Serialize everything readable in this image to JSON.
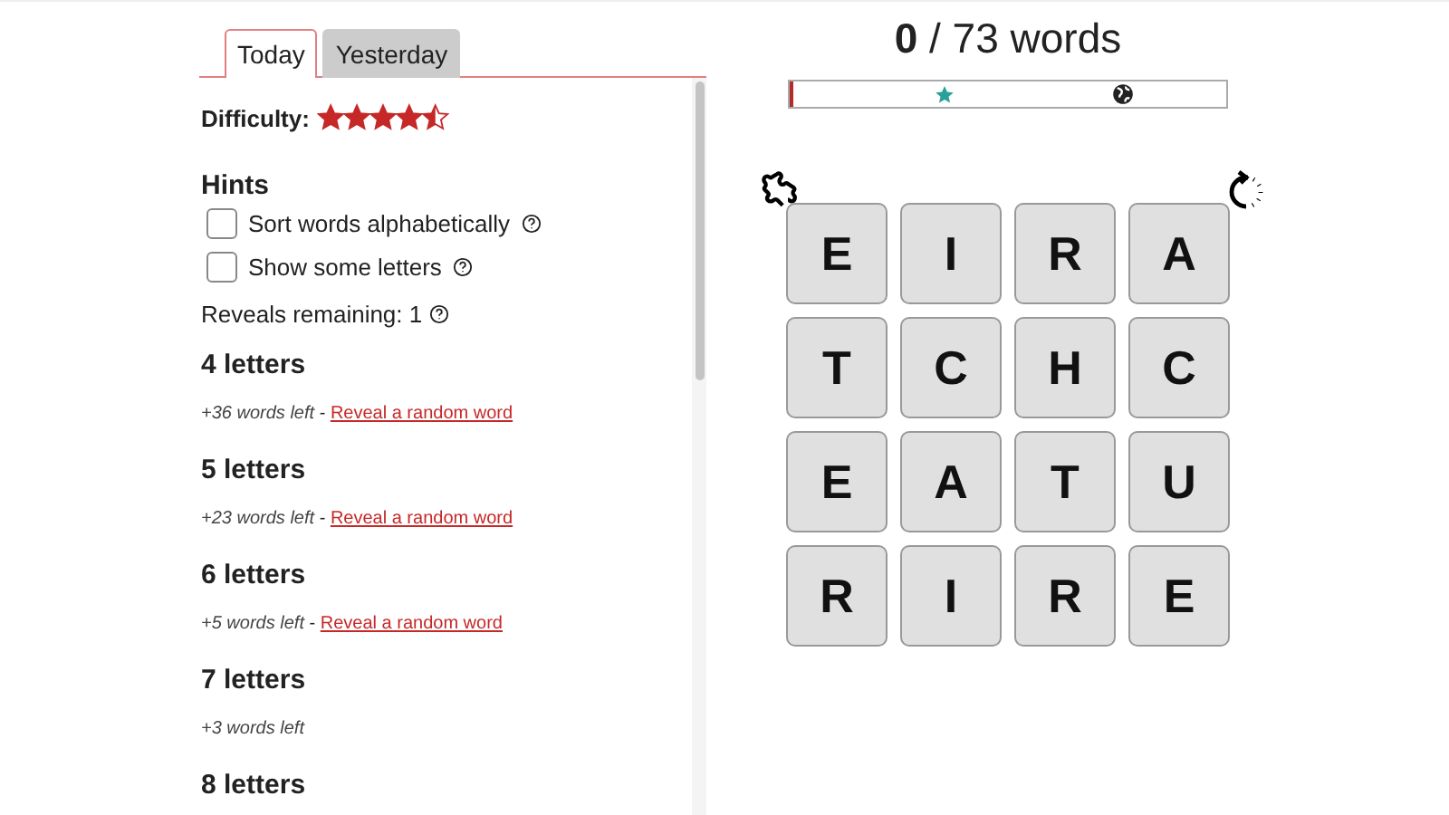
{
  "tabs": [
    {
      "label": "Today",
      "selected": true
    },
    {
      "label": "Yesterday",
      "selected": false
    }
  ],
  "difficulty": {
    "label": "Difficulty:",
    "stars": 4.5
  },
  "hints": {
    "title": "Hints",
    "options": [
      {
        "label": "Sort words alphabetically",
        "checked": false
      },
      {
        "label": "Show some letters",
        "checked": false
      }
    ],
    "reveals": "Reveals remaining: 1"
  },
  "groups": [
    {
      "title": "4 letters",
      "left": "+36 words left",
      "separator": " - ",
      "link": "Reveal a random word"
    },
    {
      "title": "5 letters",
      "left": "+23 words left",
      "separator": " - ",
      "link": "Reveal a random word"
    },
    {
      "title": "6 letters",
      "left": "+5 words left",
      "separator": " - ",
      "link": "Reveal a random word"
    },
    {
      "title": "7 letters",
      "left": "+3 words left"
    },
    {
      "title": "8 letters"
    }
  ],
  "score": {
    "found": "0",
    "total": "/ 73 words",
    "level": 0.01
  },
  "grid": [
    [
      "E",
      "I",
      "R",
      "A"
    ],
    [
      "T",
      "C",
      "H",
      "C"
    ],
    [
      "E",
      "A",
      "T",
      "U"
    ],
    [
      "R",
      "I",
      "R",
      "E"
    ]
  ]
}
